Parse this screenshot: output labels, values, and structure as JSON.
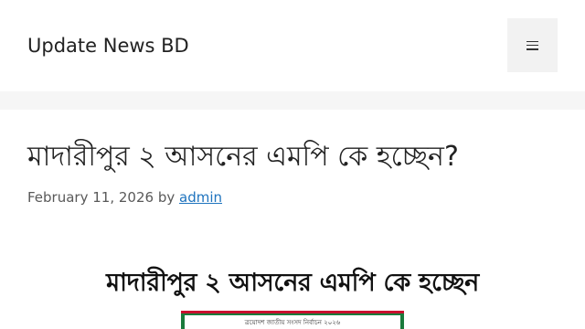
{
  "header": {
    "site_title": "Update News BD",
    "menu_icon": "hamburger-menu-icon"
  },
  "article": {
    "title": "মাদারীপুর ২ আসনের এমপি কে হচ্ছেন?",
    "date": "February 11, 2026",
    "by_label": "by",
    "author": "admin"
  },
  "featured_image": {
    "headline": "মাদারীপুর ২ আসনের এমপি কে হচ্ছেন",
    "banner_text": "ত্রয়োদশ জাতীয় সংসদ নির্বাচন ২০২৬",
    "colors": {
      "banner_green": "#1a7a3c",
      "banner_red": "#c8102e"
    }
  },
  "colors": {
    "link": "#1e73be",
    "text": "#222222",
    "meta_text": "#595959",
    "band": "#f6f6f6"
  }
}
